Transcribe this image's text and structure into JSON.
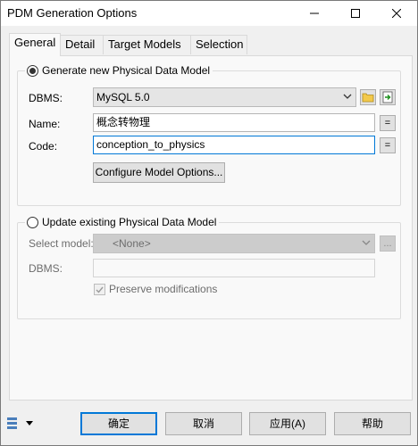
{
  "window": {
    "title": "PDM Generation Options"
  },
  "tabs": [
    {
      "label": "General",
      "active": true
    },
    {
      "label": "Detail",
      "active": false
    },
    {
      "label": "Target Models",
      "active": false
    },
    {
      "label": "Selection",
      "active": false
    }
  ],
  "generate_group": {
    "radio_label": "Generate new Physical Data Model",
    "selected": true,
    "dbms_label": "DBMS:",
    "dbms_value": "MySQL 5.0",
    "name_label": "Name:",
    "name_value": "概念转物理",
    "code_label": "Code:",
    "code_value": "conception_to_physics",
    "equals_label": "=",
    "configure_button": "Configure Model Options..."
  },
  "update_group": {
    "radio_label": "Update existing Physical Data Model",
    "selected": false,
    "select_model_label": "Select model:",
    "select_model_value": "<None>",
    "browse_label": "...",
    "dbms_label": "DBMS:",
    "dbms_value": "",
    "preserve_label": "Preserve modifications",
    "preserve_checked": true
  },
  "footer": {
    "ok": "确定",
    "cancel": "取消",
    "apply": "应用(A)",
    "help": "帮助"
  },
  "colors": {
    "accent": "#0078d7",
    "window_bg": "#f0f0f0",
    "panel_bg": "#f9f9f9"
  },
  "icons": [
    "minimize-icon",
    "maximize-icon",
    "close-icon",
    "folder-icon",
    "properties-icon",
    "chevron-down-icon",
    "checkmark-icon",
    "model-menu-icon"
  ]
}
